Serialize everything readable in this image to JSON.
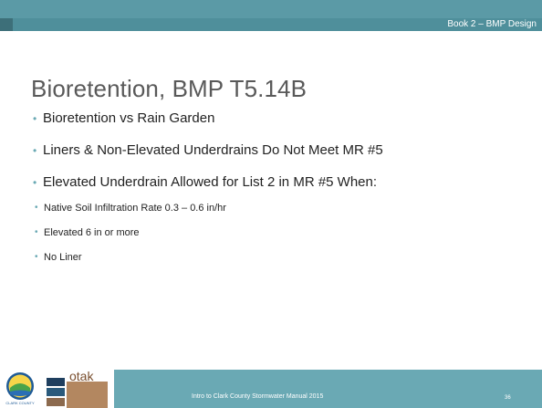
{
  "header": {
    "book_label": "Book 2 – BMP Design"
  },
  "slide": {
    "title": "Bioretention, BMP T5.14B",
    "bullets": [
      "Bioretention vs Rain Garden",
      "Liners & Non-Elevated Underdrains Do Not Meet MR #5",
      "Elevated Underdrain Allowed for List 2 in MR #5 When:"
    ],
    "sub_bullets": [
      "Native Soil Infiltration Rate 0.3 – 0.6 in/hr",
      "Elevated 6 in or more",
      "No Liner"
    ]
  },
  "footer": {
    "text": "Intro to Clark County Stormwater Manual 2015",
    "page_number": "36",
    "logo_left_text": "CLARK COUNTY",
    "logo_right_text": "otak"
  },
  "colors": {
    "accent": "#6aa9b4",
    "header_bar": "#5b9aa6",
    "title_text": "#595959"
  },
  "icons": {
    "left_logo": "clark-county-seal-icon",
    "right_logo": "otak-logo-icon"
  }
}
